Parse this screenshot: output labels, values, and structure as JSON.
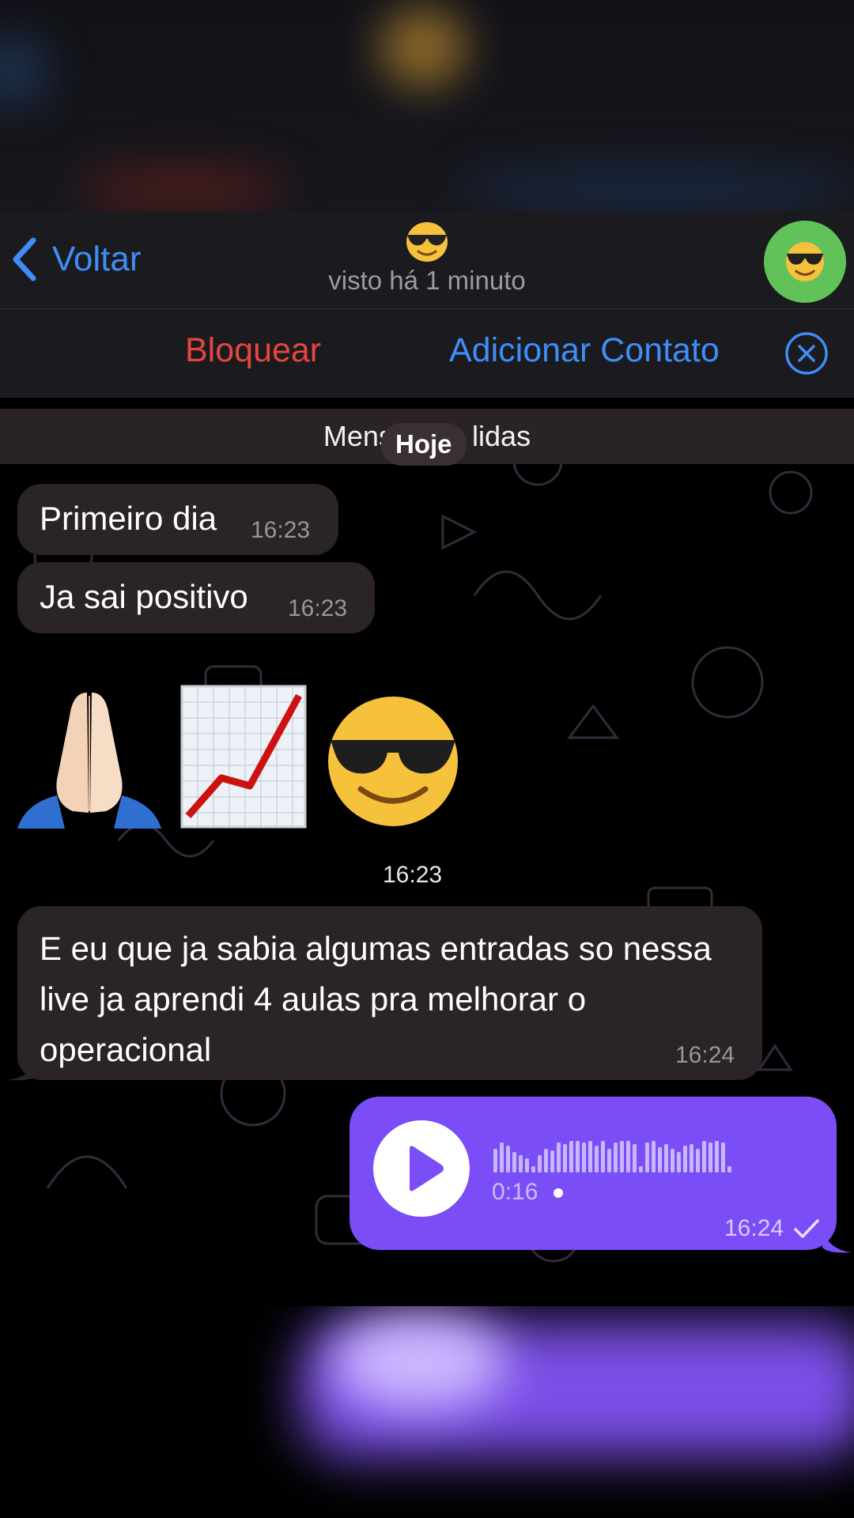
{
  "header": {
    "back_label": "Voltar",
    "status": "visto há 1 minuto",
    "contact_emoji": "smiling-face-with-sunglasses"
  },
  "actions": {
    "block_label": "Bloquear",
    "add_contact_label": "Adicionar Contato"
  },
  "chat": {
    "unread_banner": "Mensag     ão lidas",
    "date_separator": "Hoje",
    "messages": [
      {
        "direction": "incoming",
        "text": "Primeiro dia",
        "time": "16:23"
      },
      {
        "direction": "incoming",
        "text": "Ja sai positivo",
        "time": "16:23"
      },
      {
        "direction": "incoming",
        "type": "emoji",
        "emojis": [
          "folded-hands",
          "chart-increasing",
          "smiling-face-with-sunglasses"
        ],
        "time": "16:23"
      },
      {
        "direction": "incoming",
        "text": "E eu que ja sabia algumas entradas so nessa live ja aprendi 4 aulas pra melhorar o operacional",
        "time": "16:24"
      },
      {
        "direction": "outgoing",
        "type": "voice",
        "duration": "0:16",
        "time": "16:24",
        "status": "sent-check"
      }
    ]
  },
  "colors": {
    "accent_blue": "#3e8ef7",
    "block_red": "#e5463f",
    "voice_purple": "#7a4df6",
    "incoming_bubble": "#2a2328"
  }
}
